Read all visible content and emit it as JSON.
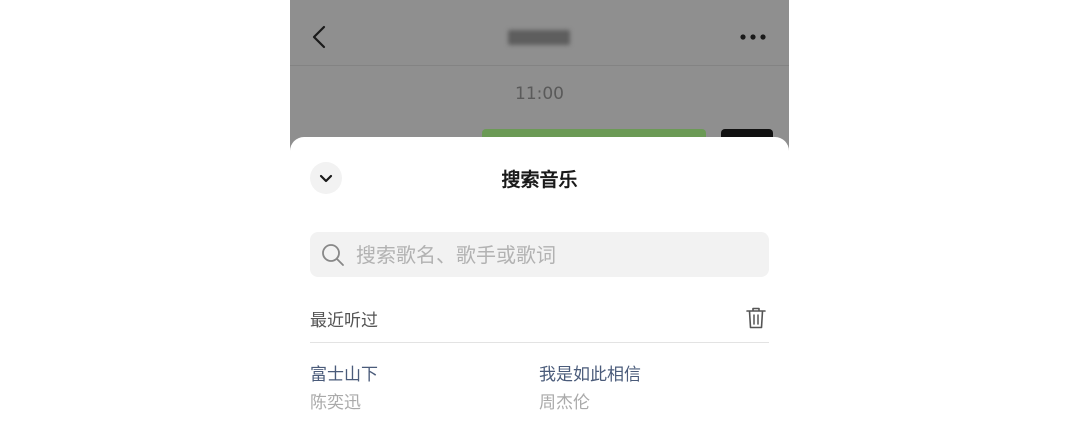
{
  "chat": {
    "time": "11:00"
  },
  "sheet": {
    "title": "搜索音乐",
    "search": {
      "placeholder": "搜索歌名、歌手或歌词",
      "value": ""
    },
    "recent_label": "最近听过",
    "recent": [
      {
        "title": "富士山下",
        "artist": "陈奕迅"
      },
      {
        "title": "我是如此相信",
        "artist": "周杰伦"
      }
    ]
  },
  "icons": {
    "back": "back-chevron-icon",
    "more": "more-dots-icon",
    "collapse": "chevron-down-icon",
    "search": "search-icon",
    "clear": "trash-icon"
  },
  "colors": {
    "overlay": "#8f8f8f",
    "sheet_bg": "#ffffff",
    "search_bg": "#f2f2f2",
    "song_title": "#4a5b7a",
    "song_artist": "#aaaaaa"
  }
}
